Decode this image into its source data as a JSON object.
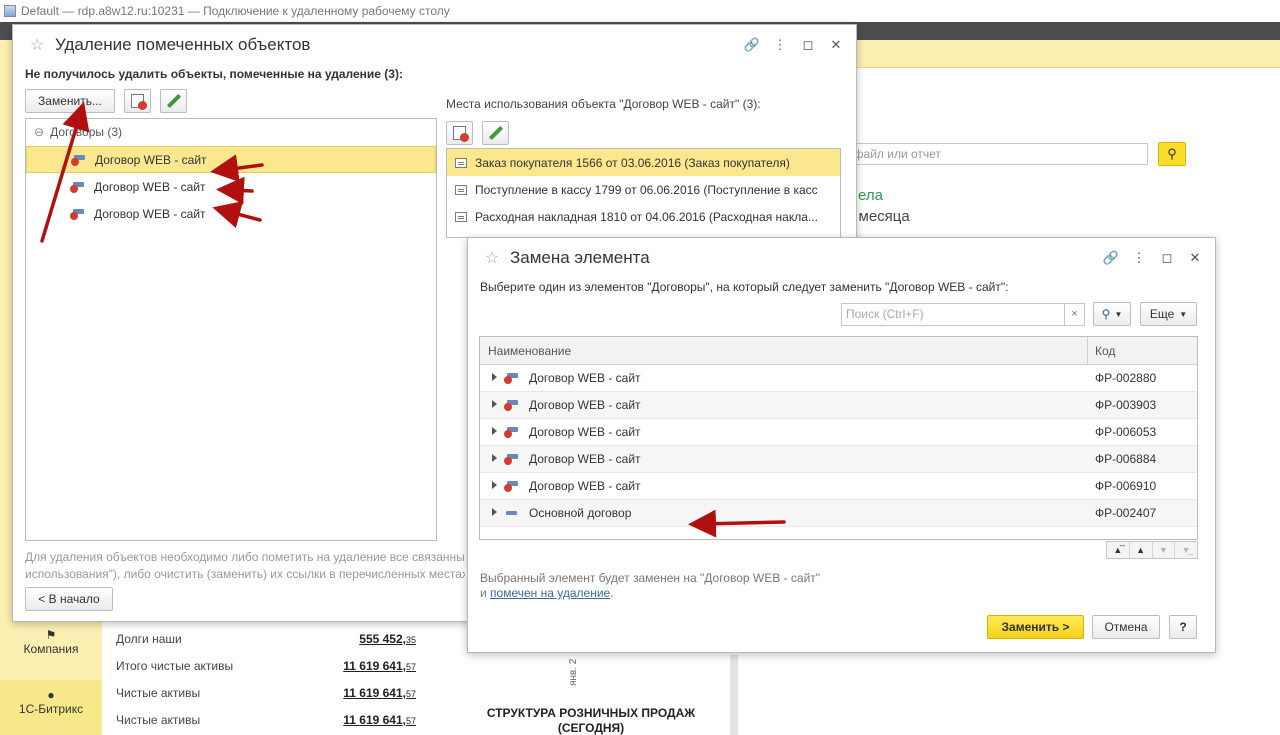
{
  "rdp": {
    "title": "Default — rdp.a8w12.ru:10231 — Подключение к удаленному рабочему столу"
  },
  "background": {
    "search_placeholder": ", файл или отчет",
    "green_text": "ела",
    "month_text": "е месяца",
    "sidebar": [
      {
        "label": "Компания",
        "icon": "flag-icon"
      },
      {
        "label": "1С-Битрикс",
        "icon": "bitrix-icon"
      }
    ],
    "finance": [
      {
        "label": "Долги наши",
        "int": "555 452,",
        "dec": "35"
      },
      {
        "label": "Итого чистые активы",
        "int": "11 619 641,",
        "dec": "57"
      },
      {
        "label": "Чистые активы",
        "int": "11 619 641,",
        "dec": "57"
      },
      {
        "label": "Чистые активы",
        "int": "11 619 641,",
        "dec": "57"
      }
    ],
    "vertical_label": "янв. 2",
    "structure_title": "СТРУКТУРА РОЗНИЧНЫХ ПРОДАЖ",
    "structure_subtitle": "(СЕГОДНЯ)"
  },
  "dialog_delete": {
    "title": "Удаление помеченных объектов",
    "header": "Не получилось удалить объекты, помеченные на удаление (3):",
    "replace_button": "Заменить...",
    "tree_group": "Договоры (3)",
    "tree_items": [
      "Договор WEB - сайт",
      "Договор WEB - сайт",
      "Договор WEB - сайт"
    ],
    "places_title": "Места использования объекта \"Договор WEB - сайт\" (3):",
    "places": [
      "Заказ покупателя 1566 от 03.06.2016  (Заказ покупателя)",
      "Поступление в кассу 1799 от 06.06.2016  (Поступление в касс",
      "Расходная накладная 1810 от 04.06.2016  (Расходная накла..."
    ],
    "note_line1": "Для удаления объектов необходимо либо пометить на удаление все связанны",
    "note_line2": "использования\"), либо очистить (заменить) их ссылки в перечисленных местах",
    "back_button": "< В начало"
  },
  "dialog_replace": {
    "title": "Замена элемента",
    "prompt": "Выберите один из элементов \"Договоры\", на который следует заменить \"Договор WEB - сайт\":",
    "search_placeholder": "Поиск (Ctrl+F)",
    "clear_symbol": "×",
    "more_button": "Еще",
    "col_name": "Наименование",
    "col_code": "Код",
    "rows": [
      {
        "name": "Договор WEB - сайт",
        "code": "ФР-002880"
      },
      {
        "name": "Договор WEB - сайт",
        "code": "ФР-003903"
      },
      {
        "name": "Договор WEB - сайт",
        "code": "ФР-006053"
      },
      {
        "name": "Договор WEB - сайт",
        "code": "ФР-006884"
      },
      {
        "name": "Договор WEB - сайт",
        "code": "ФР-006910"
      },
      {
        "name": "Основной договор",
        "code": "ФР-002407"
      }
    ],
    "info_line1": "Выбранный элемент будет заменен на \"Договор WEB - сайт\"",
    "info_and": "и ",
    "info_link": "помечен на удаление",
    "info_dot": ".",
    "replace_button": "Заменить >",
    "cancel_button": "Отмена",
    "help_button": "?"
  },
  "colors": {
    "accent_yellow": "#f4d31a",
    "selection": "#fbe78d",
    "arrow_red": "#b01010"
  }
}
